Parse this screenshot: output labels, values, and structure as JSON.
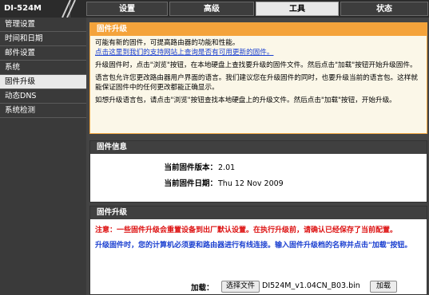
{
  "model": "DI-524M",
  "tabs": [
    "设置",
    "高级",
    "工具",
    "状态"
  ],
  "active_tab": "工具",
  "sidebar": {
    "items": [
      {
        "label": "管理设置"
      },
      {
        "label": "时间和日期"
      },
      {
        "label": "邮件设置"
      },
      {
        "label": "系统"
      },
      {
        "label": "固件升级"
      },
      {
        "label": "动态DNS"
      },
      {
        "label": "系统检测"
      }
    ],
    "active": "固件升级"
  },
  "panel_intro": {
    "title": "固件升级",
    "line1": "可能有新的固件，可提高路由器的功能和性能。",
    "link": "点击这里到我们的支持网站上查询是否有可用更新的固件。",
    "line2": "升级固件时，点击\"浏览\"按钮，在本地硬盘上查找要升级的固件文件。然后点击\"加载\"按钮开始升级固件。",
    "line3": "语言包允许您更改路由器用户界面的语言。我们建议您在升级固件的同时，也要升级当前的语言包。这样就能保证固件中的任何更改都能正确显示。",
    "line4": "如想升级语言包，请点击\"浏览\"按钮查找本地硬盘上的升级文件。然后点击\"加载\"按钮，开始升级。"
  },
  "panel_info": {
    "title": "固件信息",
    "version_label": "当前固件版本：",
    "version_value": "2.01",
    "date_label": "当前固件日期：",
    "date_value": "Thu 12 Nov 2009"
  },
  "panel_upgrade": {
    "title": "固件升级",
    "warning": "注意：一些固件升级会重置设备到出厂默认设置。在执行升级前，请确认已经保存了当前配置。",
    "note": "升级固件时，您的计算机必须要和路由器进行有线连接。输入固件升级档的名称并点击\"加载\"按钮。",
    "load_label": "加载：",
    "choose_file_button": "选择文件",
    "file_name": "DI524M_v1.04CN_B03.bin",
    "upload_button": "加载"
  }
}
